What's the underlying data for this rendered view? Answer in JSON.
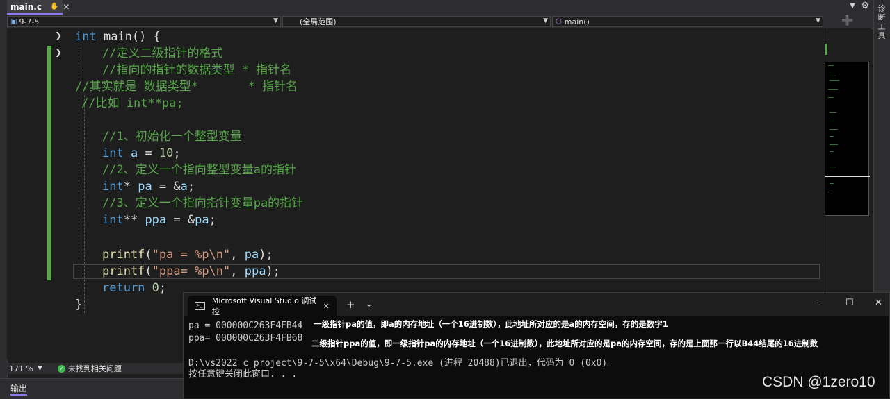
{
  "tab": {
    "filename": "main.c",
    "pin_icon": "pin-icon",
    "close_icon": "close-icon"
  },
  "right_panel": {
    "label": "诊断工具"
  },
  "nav": {
    "project": "9-7-5",
    "scope": "(全局范围)",
    "function": "main()"
  },
  "code": {
    "l1": {
      "kw": "int",
      "rest": " main() {"
    },
    "l2": "//定义二级指针的格式",
    "l3": "//指向的指针的数据类型 * 指针名",
    "l4": "//其实就是 数据类型*       * 指针名",
    "l5": "//比如 int**pa;",
    "l6": "//1、初始化一个整型变量",
    "l7": {
      "kw": "int",
      "var": "a",
      "op": " = ",
      "num": "10",
      "end": ";"
    },
    "l8": "//2、定义一个指向整型变量a的指针",
    "l9": {
      "kw": "int",
      "star": "* ",
      "var": "pa",
      "op": " = &",
      "var2": "a",
      "end": ";"
    },
    "l10": "//3、定义一个指向指针变量pa的指针",
    "l11": {
      "kw": "int",
      "star": "** ",
      "var": "ppa",
      "op": " = &",
      "var2": "pa",
      "end": ";"
    },
    "l12": {
      "fn": "printf",
      "open": "(",
      "str": "\"pa = %p\\n\"",
      "comma": ", ",
      "var": "pa",
      "end": ");"
    },
    "l13": {
      "fn": "printf",
      "open": "(",
      "str": "\"ppa= %p\\n\"",
      "comma": ", ",
      "var": "ppa",
      "end": ");"
    },
    "l14": {
      "kw": "return",
      "num": "0",
      "end": ";"
    },
    "l15": "}"
  },
  "status": {
    "zoom": "171 %",
    "issues": "未找到相关问题"
  },
  "output_panel": {
    "title": "输出"
  },
  "console": {
    "tab_title": "Microsoft Visual Studio 调试控",
    "line1": "pa = 000000C263F4FB44",
    "line2": "ppa= 000000C263F4FB68",
    "annotation1": "一级指针pa的值，即a的内存地址（一个16进制数），此地址所对应的是a的内存空间，存的是数字1",
    "annotation2": "二级指针ppa的值，即一级指针pa的内存地址（一个16进制数），此地址所对应的是pa的内存空间，存的是上面那一行以B44结尾的16进制数",
    "line3": "D:\\vs2022 c project\\9-7-5\\x64\\Debug\\9-7-5.exe (进程 20488)已退出，代码为 0 (0x0)。",
    "line4": "按任意键关闭此窗口. . ."
  },
  "watermark": "CSDN @1zero10",
  "colors": {
    "keyword": "#569cd6",
    "comment": "#57a64a",
    "string": "#d69d85",
    "function": "#dcdcaa",
    "variable": "#9cdcfe",
    "number": "#b5cea8",
    "accent": "#8a7cf0"
  }
}
